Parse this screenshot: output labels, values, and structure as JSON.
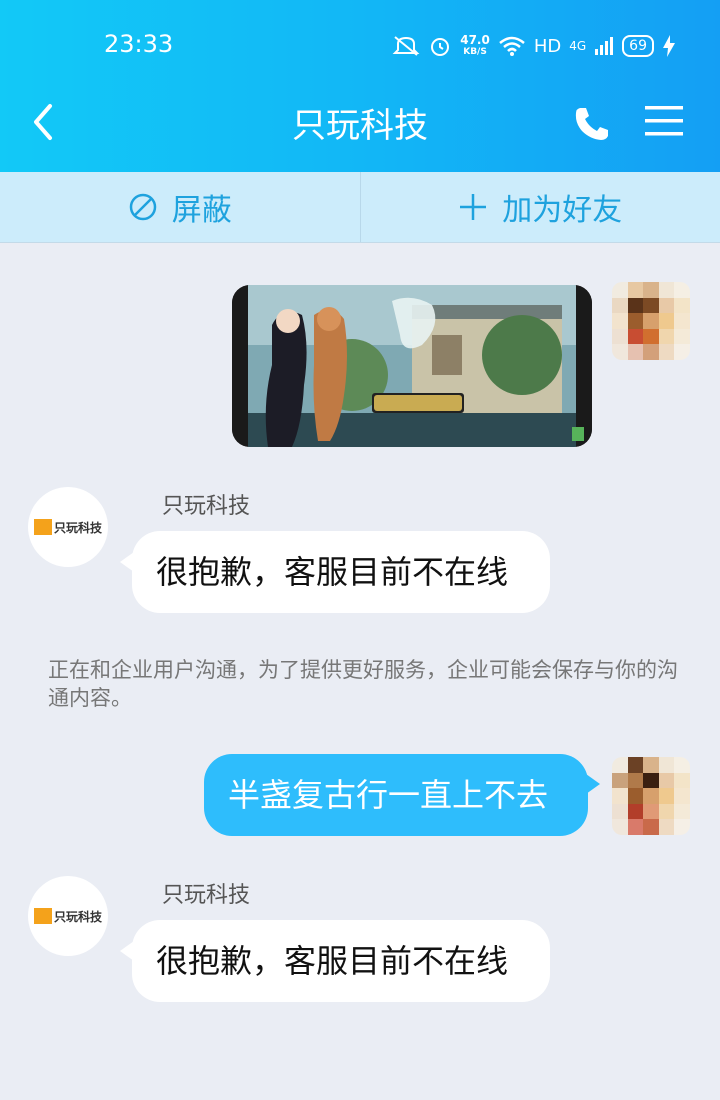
{
  "status_bar": {
    "time": "23:33",
    "speed_value": "47.0",
    "speed_unit": "KB/S",
    "hd": "HD",
    "network": "4G",
    "battery": "69"
  },
  "header": {
    "title": "只玩科技"
  },
  "actions": {
    "block_label": "屏蔽",
    "add_friend_label": "加为好友"
  },
  "messages": [
    {
      "type": "image"
    },
    {
      "type": "incoming",
      "sender": "只玩科技",
      "text": "很抱歉，客服目前不在线"
    },
    {
      "type": "notice",
      "text": "正在和企业用户沟通，为了提供更好服务，企业可能会保存与你的沟通内容。"
    },
    {
      "type": "outgoing",
      "text": "半盏复古行一直上不去"
    },
    {
      "type": "incoming",
      "sender": "只玩科技",
      "text": "很抱歉，客服目前不在线"
    }
  ],
  "corp_logo_text": "只玩科技",
  "colors": {
    "header_start": "#12c9f7",
    "header_end": "#149ff4",
    "action_bar": "#ccecfb",
    "action_text": "#1ea2de",
    "outgoing_bubble": "#2ebdfc",
    "background": "#eaedf4"
  }
}
